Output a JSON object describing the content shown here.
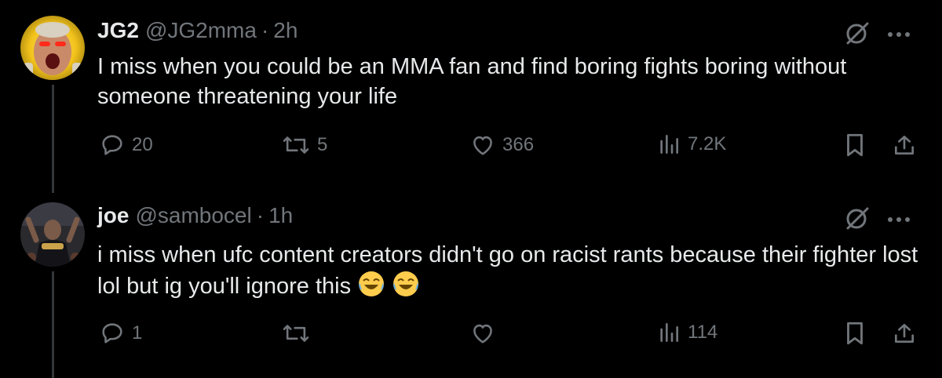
{
  "tweets": [
    {
      "name": "JG2",
      "handle": "@JG2mma",
      "separator": "·",
      "time": "2h",
      "text": "I miss when you could be an MMA fan and find boring fights boring without someone threatening your life",
      "replies": "20",
      "reposts": "5",
      "likes": "366",
      "views": "7.2K"
    },
    {
      "name": "joe",
      "handle": "@sambocel",
      "separator": "·",
      "time": "1h",
      "text": "i miss when ufc content creators didn't go on racist rants because their fighter lost lol but ig you'll ignore this",
      "replies": "1",
      "reposts": "",
      "likes": "",
      "views": "114"
    }
  ],
  "icons": [
    "grok-icon",
    "more-icon",
    "reply-icon",
    "repost-icon",
    "like-icon",
    "views-icon",
    "bookmark-icon",
    "share-icon",
    "laughing-emoji"
  ],
  "colors": {
    "background": "#000000",
    "text": "#e7e9ea",
    "secondary": "#71767b",
    "thread_line": "#333639"
  }
}
